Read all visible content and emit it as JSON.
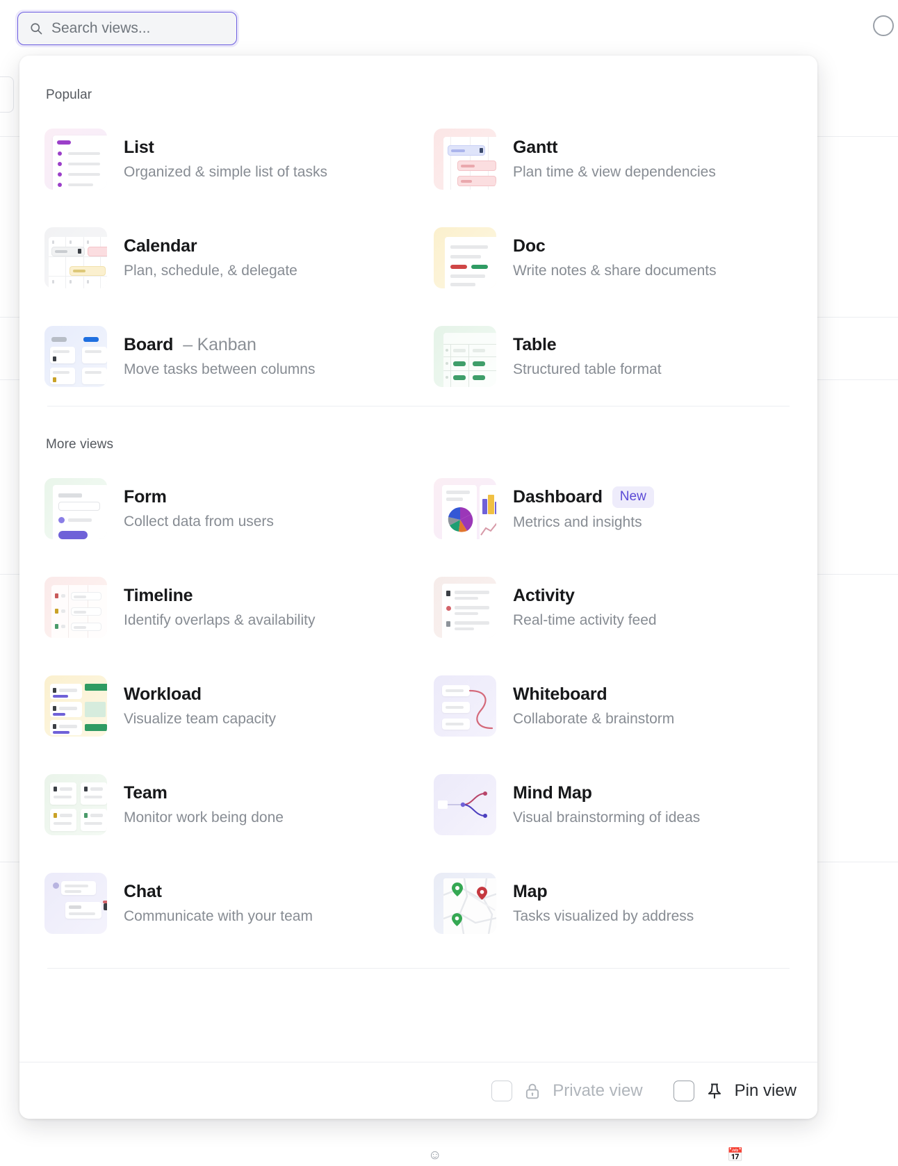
{
  "search": {
    "placeholder": "Search views...",
    "value": "",
    "icon": "search-icon"
  },
  "sections": [
    {
      "label": "Popular"
    },
    {
      "label": "More views"
    }
  ],
  "popular_views": [
    {
      "title": "List",
      "suffix": "",
      "desc": "Organized & simple list of tasks",
      "icon": "list-view-icon",
      "badge": ""
    },
    {
      "title": "Gantt",
      "suffix": "",
      "desc": "Plan time & view dependencies",
      "icon": "gantt-view-icon",
      "badge": ""
    },
    {
      "title": "Calendar",
      "suffix": "",
      "desc": "Plan, schedule, & delegate",
      "icon": "calendar-view-icon",
      "badge": ""
    },
    {
      "title": "Doc",
      "suffix": "",
      "desc": "Write notes & share documents",
      "icon": "doc-view-icon",
      "badge": ""
    },
    {
      "title": "Board",
      "suffix": "– Kanban",
      "desc": "Move tasks between columns",
      "icon": "board-view-icon",
      "badge": ""
    },
    {
      "title": "Table",
      "suffix": "",
      "desc": "Structured table format",
      "icon": "table-view-icon",
      "badge": ""
    }
  ],
  "more_views": [
    {
      "title": "Form",
      "suffix": "",
      "desc": "Collect data from users",
      "icon": "form-view-icon",
      "badge": ""
    },
    {
      "title": "Dashboard",
      "suffix": "",
      "desc": "Metrics and insights",
      "icon": "dashboard-view-icon",
      "badge": "New"
    },
    {
      "title": "Timeline",
      "suffix": "",
      "desc": "Identify overlaps & availability",
      "icon": "timeline-view-icon",
      "badge": ""
    },
    {
      "title": "Activity",
      "suffix": "",
      "desc": "Real-time activity feed",
      "icon": "activity-view-icon",
      "badge": ""
    },
    {
      "title": "Workload",
      "suffix": "",
      "desc": "Visualize team capacity",
      "icon": "workload-view-icon",
      "badge": ""
    },
    {
      "title": "Whiteboard",
      "suffix": "",
      "desc": "Collaborate & brainstorm",
      "icon": "whiteboard-view-icon",
      "badge": ""
    },
    {
      "title": "Team",
      "suffix": "",
      "desc": "Monitor work being done",
      "icon": "team-view-icon",
      "badge": ""
    },
    {
      "title": "Mind Map",
      "suffix": "",
      "desc": "Visual brainstorming of ideas",
      "icon": "mindmap-view-icon",
      "badge": ""
    },
    {
      "title": "Chat",
      "suffix": "",
      "desc": "Communicate with your team",
      "icon": "chat-view-icon",
      "badge": ""
    },
    {
      "title": "Map",
      "suffix": "",
      "desc": "Tasks visualized by address",
      "icon": "map-view-icon",
      "badge": ""
    }
  ],
  "footer": {
    "private_view": {
      "label": "Private view",
      "icon": "lock-icon",
      "checked": false,
      "disabled": true
    },
    "pin_view": {
      "label": "Pin view",
      "icon": "pin-icon",
      "checked": false,
      "disabled": false
    }
  },
  "colors": {
    "accent": "#6b5ce0",
    "badge_text": "#5b4ad6",
    "badge_bg": "#eeecfb",
    "title": "#17181a",
    "muted": "#878c93"
  }
}
